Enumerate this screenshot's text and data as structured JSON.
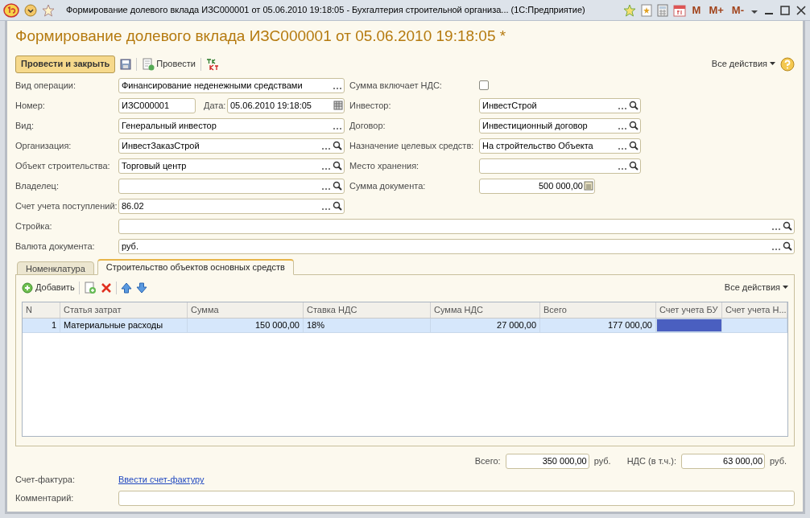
{
  "window": {
    "title": "Формирование долевого вклада ИЗС000001 от 05.06.2010 19:18:05 - Бухгалтерия строительной организа... (1С:Предприятие)",
    "memory_buttons": [
      "M",
      "M+",
      "M-"
    ]
  },
  "header": {
    "title": "Формирование долевого вклада ИЗС000001 от 05.06.2010 19:18:05 *"
  },
  "toolbar": {
    "primary": "Провести и закрыть",
    "post": "Провести",
    "all_actions": "Все действия"
  },
  "operation": {
    "label": "Вид операции:",
    "value": "Финансирование неденежными средствами",
    "search": false
  },
  "number": {
    "label": "Номер:",
    "value": "ИЗС000001",
    "date_label": "Дата:",
    "date": "05.06.2010 19:18:05"
  },
  "left_fields": [
    {
      "label": "Вид:",
      "value": "Генеральный инвестор",
      "search": false
    },
    {
      "label": "Организация:",
      "value": "ИнвестЗаказСтрой",
      "search": true
    },
    {
      "label": "Объект строительства:",
      "value": "Торговый центр",
      "search": true
    },
    {
      "label": "Владелец:",
      "search": true
    },
    {
      "label": "Счет учета поступлений:",
      "value": "86.02",
      "search": true
    }
  ],
  "vat_included": {
    "label": "Сумма включает НДС:",
    "checked": false
  },
  "right_fields": [
    {
      "label": "Инвестор:",
      "value": "ИнвестСтрой",
      "kind": "ref"
    },
    {
      "label": "Договор:",
      "value": "Инвестиционный договор",
      "kind": "ref"
    },
    {
      "label": "Назначение целевых средств:",
      "value": "На стройтельство Объекта",
      "kind": "ref"
    },
    {
      "label": "Место хранения:",
      "kind": "ref"
    },
    {
      "label": "Сумма документа:",
      "value": "500 000,00",
      "kind": "number"
    }
  ],
  "wide_fields": [
    {
      "label": "Стройка:"
    },
    {
      "label": "Валюта документа:",
      "value": "руб."
    }
  ],
  "tabs": [
    {
      "label": "Номенклатура",
      "selected": false
    },
    {
      "label": "Строительство объектов основных средств",
      "selected": true
    }
  ],
  "table_toolbar": {
    "add": "Добавить",
    "all_actions": "Все действия"
  },
  "table": {
    "columns": [
      "N",
      "Статья затрат",
      "Сумма",
      "Ставка НДС",
      "Сумма НДС",
      "Всего",
      "Счет учета БУ",
      "Счет учета Н..."
    ],
    "rows": [
      {
        "selected": true,
        "cells": [
          "1",
          "Материальные расходы",
          "150 000,00",
          "18%",
          "27 000,00",
          "177 000,00",
          "",
          ""
        ]
      }
    ]
  },
  "totals": {
    "total_label": "Всего:",
    "total": "350 000,00",
    "total_currency": "руб.",
    "vat_label": "НДС (в т.ч.):",
    "vat": "63 000,00",
    "vat_currency": "руб."
  },
  "invoice": {
    "label": "Счет-фактура:",
    "link": "Ввести счет-фактуру"
  },
  "comment": {
    "label": "Комментарий:"
  }
}
